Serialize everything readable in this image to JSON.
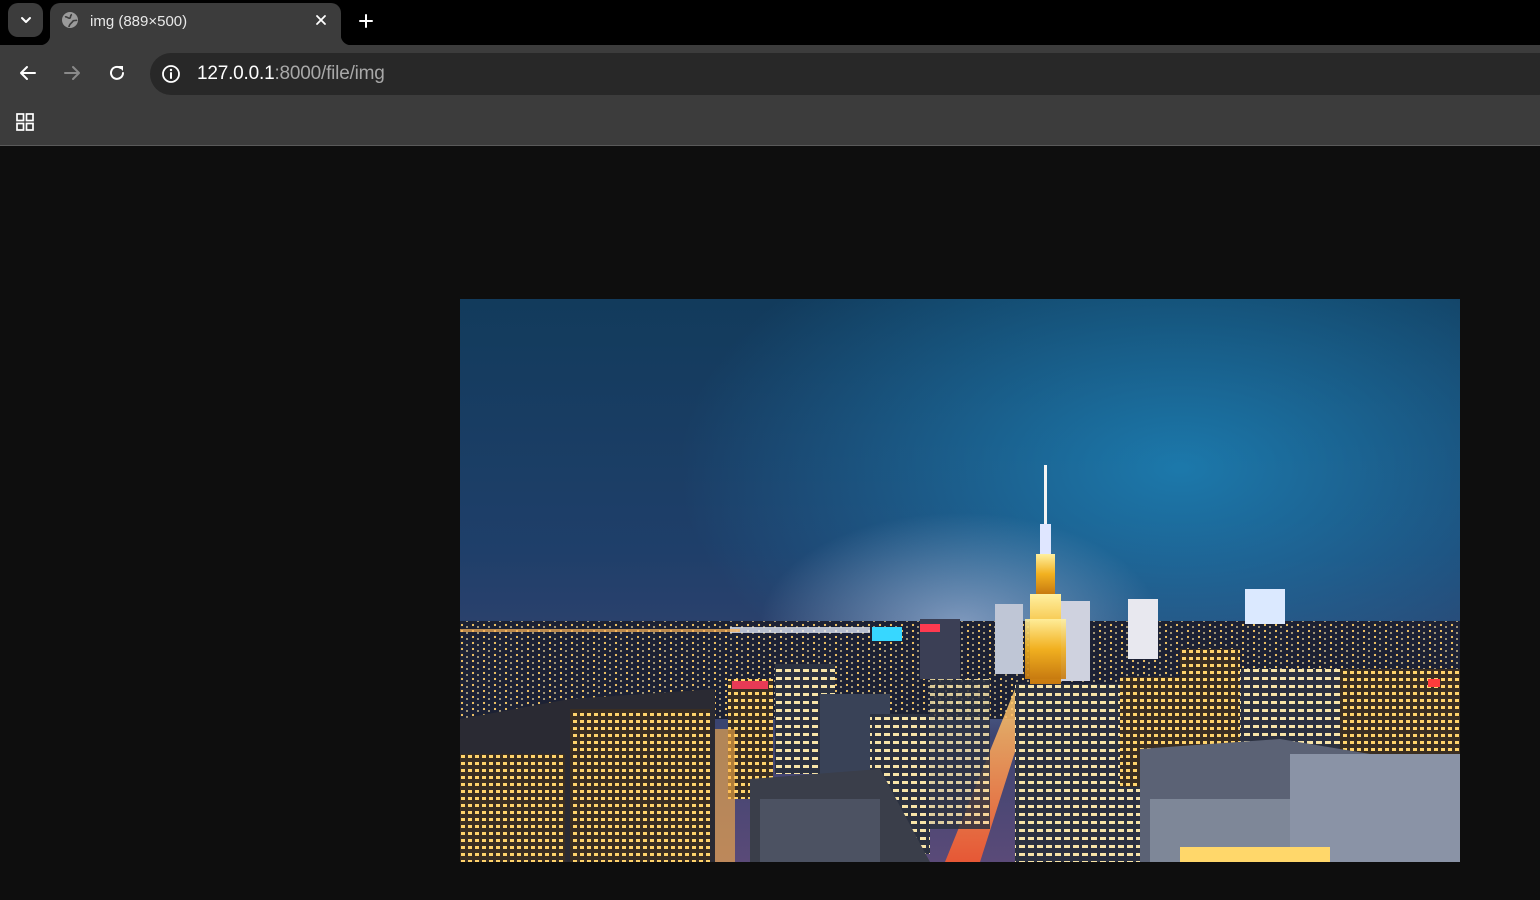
{
  "tab": {
    "title": "img (889×500)",
    "favicon": "globe-icon"
  },
  "toolbar": {
    "back_icon": "arrow-left-icon",
    "forward_icon": "arrow-right-icon",
    "reload_icon": "reload-icon",
    "url_host": "127.0.0.1",
    "url_path": ":8000/file/img",
    "site_info_icon": "info-icon"
  },
  "bookmarks": {
    "apps_icon": "apps-grid-icon"
  },
  "colors": {
    "page_background": "#0e0e0e",
    "chrome": "#3c3c3c",
    "tabstrip": "#000000",
    "omnibox": "#282828"
  }
}
